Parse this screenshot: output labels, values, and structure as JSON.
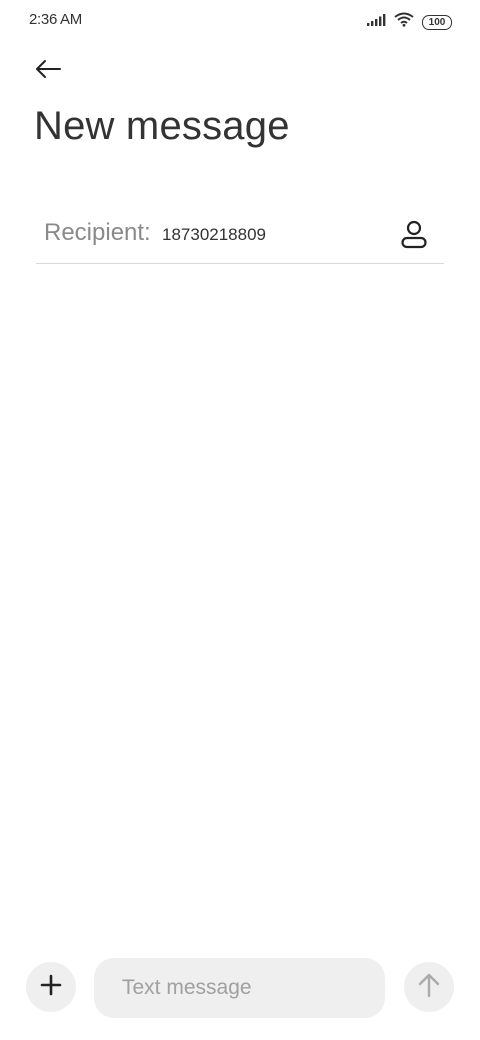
{
  "status_bar": {
    "time": "2:36 AM",
    "battery": "100",
    "icons": [
      "signal-icon",
      "wifi-icon",
      "battery-icon"
    ]
  },
  "header": {
    "back_icon": "arrow-left-icon",
    "title": "New message"
  },
  "recipient": {
    "label": "Recipient:",
    "value": "18730218809",
    "contact_icon": "contact-person-icon"
  },
  "composer": {
    "add_icon": "plus-icon",
    "placeholder": "Text message",
    "value": "",
    "send_icon": "arrow-up-icon"
  },
  "colors": {
    "background": "#ffffff",
    "pill": "#efefef",
    "muted_text": "#8a8a8a",
    "primary_text": "#333333"
  }
}
